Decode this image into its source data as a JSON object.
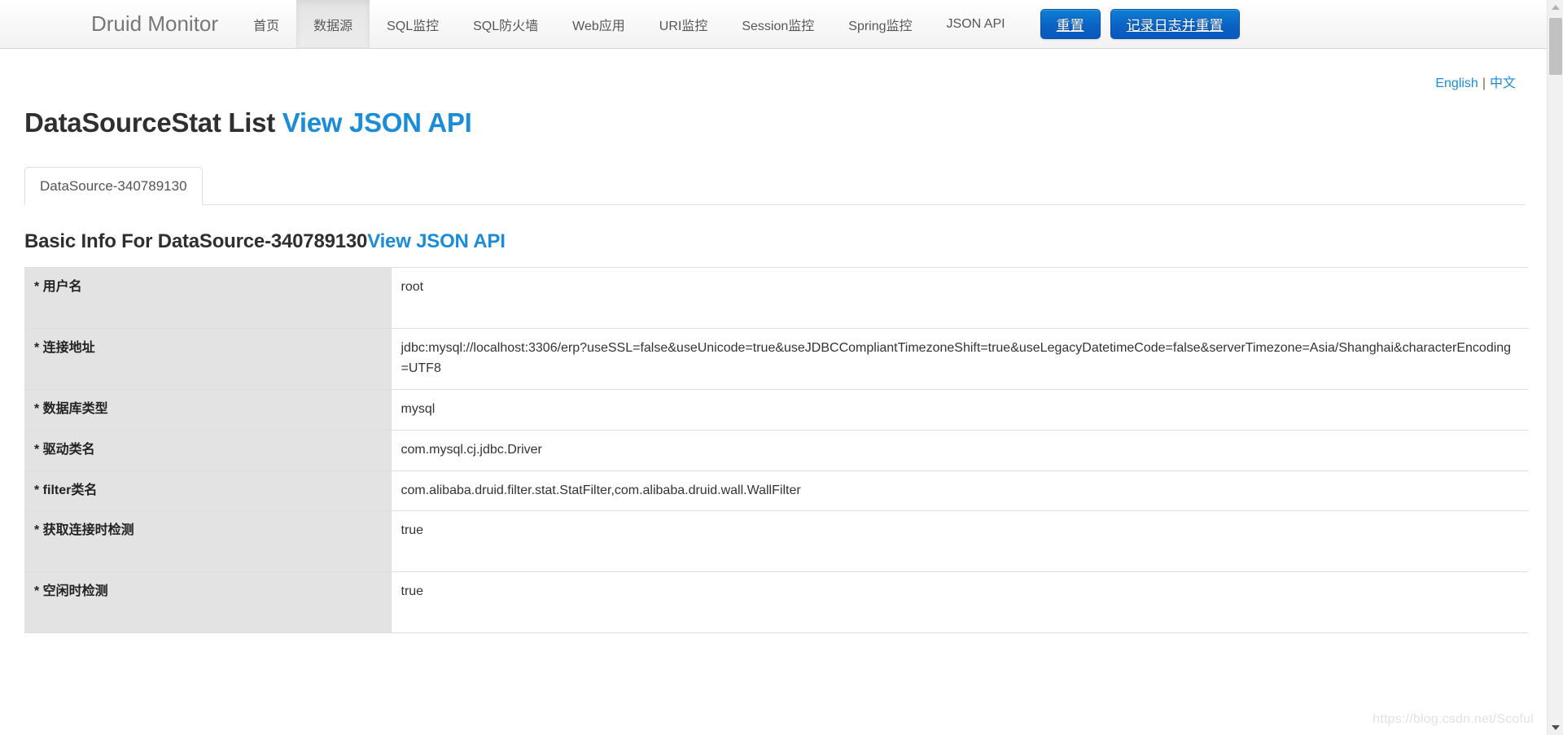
{
  "navbar": {
    "brand": "Druid Monitor",
    "links": [
      {
        "label": "首页",
        "active": false
      },
      {
        "label": "数据源",
        "active": true
      },
      {
        "label": "SQL监控",
        "active": false
      },
      {
        "label": "SQL防火墙",
        "active": false
      },
      {
        "label": "Web应用",
        "active": false
      },
      {
        "label": "URI监控",
        "active": false
      },
      {
        "label": "Session监控",
        "active": false
      },
      {
        "label": "Spring监控",
        "active": false
      },
      {
        "label": "JSON API",
        "active": false
      }
    ],
    "reset_button": "重置",
    "log_and_reset_button": "记录日志并重置"
  },
  "lang": {
    "english": "English",
    "separator": "|",
    "chinese": "中文"
  },
  "page": {
    "title": "DataSourceStat List",
    "title_link": "View JSON API",
    "section_title": "Basic Info For DataSource-340789130",
    "section_title_link": "View JSON API"
  },
  "tabs": [
    {
      "label": "DataSource-340789130",
      "active": true
    }
  ],
  "info_table": {
    "rows": [
      {
        "key": "* 用户名",
        "value": "root",
        "height": "tall"
      },
      {
        "key": "* 连接地址",
        "value": "jdbc:mysql://localhost:3306/erp?useSSL=false&useUnicode=true&useJDBCCompliantTimezoneShift=true&useLegacyDatetimeCode=false&serverTimezone=Asia/Shanghai&characterEncoding=UTF8",
        "height": "tall"
      },
      {
        "key": "* 数据库类型",
        "value": "mysql",
        "height": "short"
      },
      {
        "key": "* 驱动类名",
        "value": "com.mysql.cj.jdbc.Driver",
        "height": "short"
      },
      {
        "key": "* filter类名",
        "value": "com.alibaba.druid.filter.stat.StatFilter,com.alibaba.druid.wall.WallFilter",
        "height": "short"
      },
      {
        "key": "* 获取连接时检测",
        "value": "true",
        "height": "tall"
      },
      {
        "key": "* 空闲时检测",
        "value": "true",
        "height": "tall"
      }
    ]
  },
  "watermark": "https://blog.csdn.net/Scoful",
  "colors": {
    "accent": "#1a8cd8",
    "button": "#0b63c4",
    "header_bg": "#f2f2f2",
    "row_key_bg": "#e3e3e3"
  }
}
